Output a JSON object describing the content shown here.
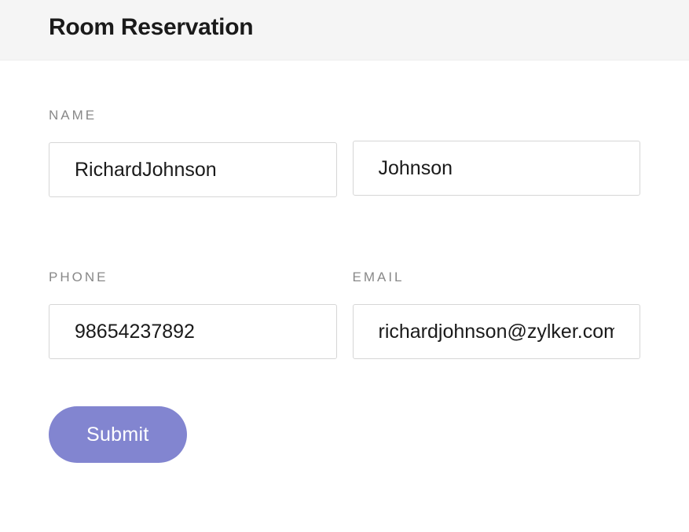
{
  "header": {
    "title": "Room Reservation"
  },
  "form": {
    "name_label": "NAME",
    "first_name": "RichardJohnson",
    "last_name": "Johnson",
    "phone_label": "PHONE",
    "phone": "98654237892",
    "email_label": "EMAIL",
    "email": "richardjohnson@zylker.com",
    "submit_label": "Submit"
  }
}
